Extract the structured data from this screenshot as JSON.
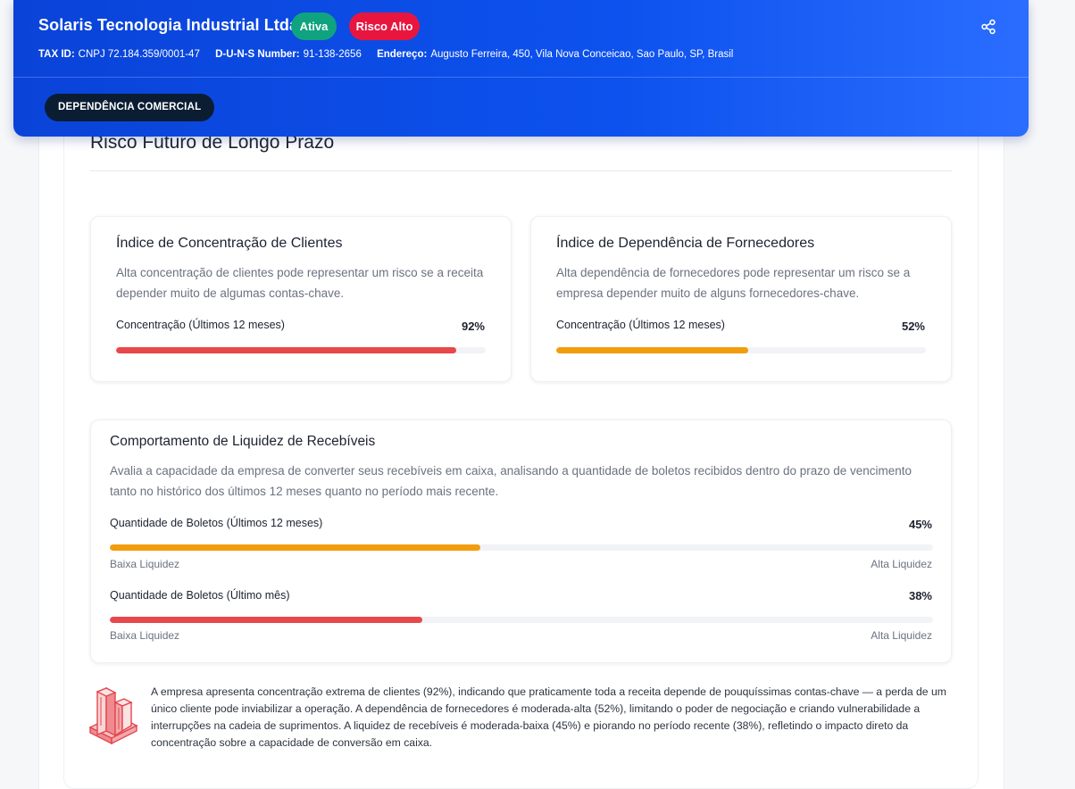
{
  "header": {
    "company_name": "Solaris Tecnologia Industrial Ltda",
    "status_badge": "Ativa",
    "risk_badge": "Risco Alto",
    "tax_id_label": "TAX ID:",
    "tax_id": "CNPJ 72.184.359/0001-47",
    "duns_label": "D-U-N-S Number:",
    "duns": "91-138-2656",
    "address_label": "Endereço:",
    "address": "Augusto Ferreira, 450, Vila Nova Conceicao, Sao Paulo, SP, Brasil",
    "tab_label": "DEPENDÊNCIA COMERCIAL",
    "share_icon": "share-icon"
  },
  "section": {
    "title": "Risco Futuro de Longo Prazo"
  },
  "cards": {
    "clients": {
      "title": "Índice de Concentração de Clientes",
      "description": "Alta concentração de clientes pode representar um risco se a receita depender muito de algumas contas-chave.",
      "bar_label": "Concentração (Últimos 12 meses)",
      "value_text": "92%",
      "value": 92,
      "color": "#e8484a"
    },
    "suppliers": {
      "title": "Índice de Dependência de Fornecedores",
      "description": "Alta dependência de fornecedores pode representar um risco se a empresa depender muito de alguns fornecedores-chave.",
      "bar_label": "Concentração (Últimos 12 meses)",
      "value_text": "52%",
      "value": 52,
      "color": "#f29d0e"
    }
  },
  "liquidity": {
    "title": "Comportamento de Liquidez de Recebíveis",
    "description": "Avalia a capacidade da empresa de converter seus recebíveis em caixa, analisando a quantidade de boletos recibidos dentro do prazo de vencimento tanto no histórico dos últimos 12 meses quanto no período mais recente.",
    "low_label": "Baixa Liquidez",
    "high_label": "Alta Liquidez",
    "bars": [
      {
        "label": "Quantidade de Boletos (Últimos 12 meses)",
        "value_text": "45%",
        "value": 45,
        "color": "#f29d0e"
      },
      {
        "label": "Quantidade de Boletos (Último mês)",
        "value_text": "38%",
        "value": 38,
        "color": "#e8484a"
      }
    ]
  },
  "summary": {
    "icon": "building-risk-icon",
    "text": "A empresa apresenta concentração extrema de clientes (92%), indicando que praticamente toda a receita depende de pouquíssimas contas-chave — a perda de um único cliente pode inviabilizar a operação. A dependência de fornecedores é moderada-alta (52%), limitando o poder de negociação e criando vulnerabilidade a interrupções na cadeia de suprimentos. A liquidez de recebíveis é moderada-baixa (45%) e piorando no período recente (38%), refletindo o impacto direto da concentração sobre a capacidade de conversão em caixa."
  }
}
